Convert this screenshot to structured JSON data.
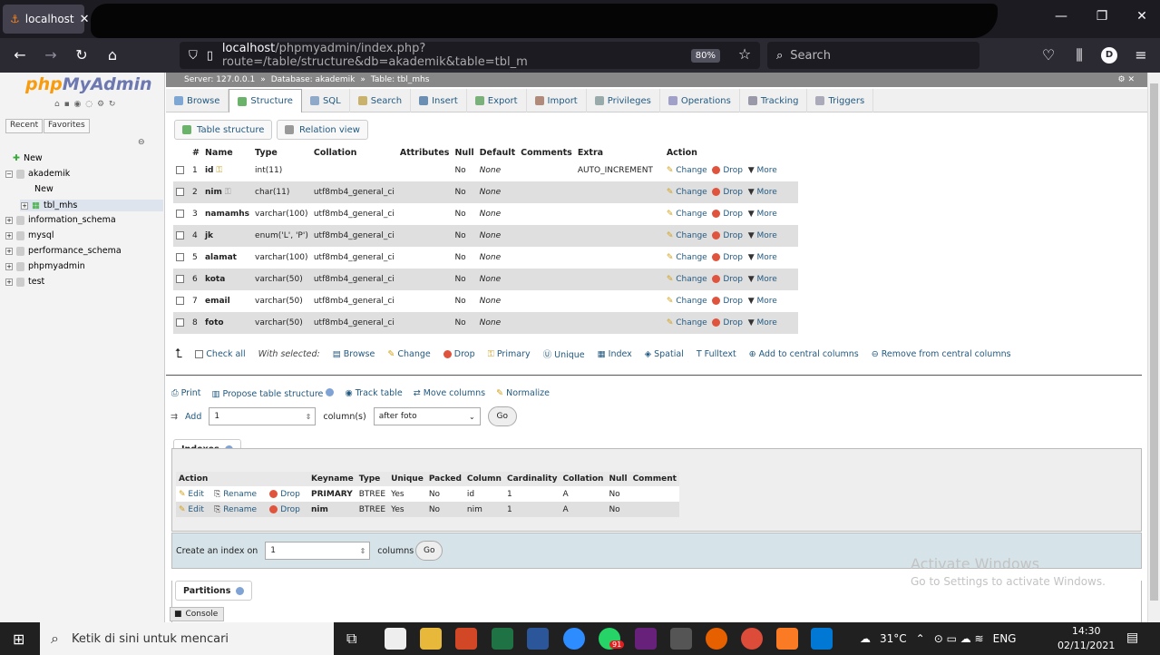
{
  "browser": {
    "tab_title": "localhost",
    "url_host": "localhost",
    "url_path": "/phpmyadmin/index.php?route=/table/structure&db=akademik&table=tbl_m",
    "zoom": "80%",
    "search_placeholder": "Search",
    "avatar_letter": "D"
  },
  "sidebar": {
    "logo_php": "php",
    "logo_myadmin": "MyAdmin",
    "tab_recent": "Recent",
    "tab_favorites": "Favorites",
    "tree": [
      "New",
      "akademik",
      "New",
      "tbl_mhs",
      "information_schema",
      "mysql",
      "performance_schema",
      "phpmyadmin",
      "test"
    ]
  },
  "breadcrumb": {
    "server": "Server: 127.0.0.1",
    "database": "Database: akademik",
    "table": "Table: tbl_mhs"
  },
  "topmenu": [
    "Browse",
    "Structure",
    "SQL",
    "Search",
    "Insert",
    "Export",
    "Import",
    "Privileges",
    "Operations",
    "Tracking",
    "Triggers"
  ],
  "subtabs": {
    "table_structure": "Table structure",
    "relation_view": "Relation view"
  },
  "structure": {
    "headers": [
      "#",
      "Name",
      "Type",
      "Collation",
      "Attributes",
      "Null",
      "Default",
      "Comments",
      "Extra",
      "Action"
    ],
    "rows": [
      {
        "num": "1",
        "name": "id",
        "type": "int(11)",
        "collation": "",
        "null": "No",
        "default": "None",
        "extra": "AUTO_INCREMENT"
      },
      {
        "num": "2",
        "name": "nim",
        "type": "char(11)",
        "collation": "utf8mb4_general_ci",
        "null": "No",
        "default": "None",
        "extra": ""
      },
      {
        "num": "3",
        "name": "namamhs",
        "type": "varchar(100)",
        "collation": "utf8mb4_general_ci",
        "null": "No",
        "default": "None",
        "extra": ""
      },
      {
        "num": "4",
        "name": "jk",
        "type": "enum('L', 'P')",
        "collation": "utf8mb4_general_ci",
        "null": "No",
        "default": "None",
        "extra": ""
      },
      {
        "num": "5",
        "name": "alamat",
        "type": "varchar(100)",
        "collation": "utf8mb4_general_ci",
        "null": "No",
        "default": "None",
        "extra": ""
      },
      {
        "num": "6",
        "name": "kota",
        "type": "varchar(50)",
        "collation": "utf8mb4_general_ci",
        "null": "No",
        "default": "None",
        "extra": ""
      },
      {
        "num": "7",
        "name": "email",
        "type": "varchar(50)",
        "collation": "utf8mb4_general_ci",
        "null": "No",
        "default": "None",
        "extra": ""
      },
      {
        "num": "8",
        "name": "foto",
        "type": "varchar(50)",
        "collation": "utf8mb4_general_ci",
        "null": "No",
        "default": "None",
        "extra": ""
      }
    ],
    "action_change": "Change",
    "action_drop": "Drop",
    "action_more": "More"
  },
  "bulk": {
    "check_all": "Check all",
    "with_selected": "With selected:",
    "actions": [
      "Browse",
      "Change",
      "Drop",
      "Primary",
      "Unique",
      "Index",
      "Spatial",
      "Fulltext",
      "Add to central columns",
      "Remove from central columns"
    ]
  },
  "tools": [
    "Print",
    "Propose table structure",
    "Track table",
    "Move columns",
    "Normalize"
  ],
  "add_column": {
    "label": "Add",
    "count": "1",
    "unit": "column(s)",
    "position": "after foto",
    "go": "Go"
  },
  "indexes": {
    "title": "Indexes",
    "headers": [
      "Action",
      "",
      "",
      "Keyname",
      "Type",
      "Unique",
      "Packed",
      "Column",
      "Cardinality",
      "Collation",
      "Null",
      "Comment"
    ],
    "edit": "Edit",
    "rename": "Rename",
    "drop": "Drop",
    "rows": [
      {
        "keyname": "PRIMARY",
        "type": "BTREE",
        "unique": "Yes",
        "packed": "No",
        "column": "id",
        "cardinality": "1",
        "collation": "A",
        "null": "No",
        "comment": ""
      },
      {
        "keyname": "nim",
        "type": "BTREE",
        "unique": "Yes",
        "packed": "No",
        "column": "nim",
        "cardinality": "1",
        "collation": "A",
        "null": "No",
        "comment": ""
      }
    ]
  },
  "create_index": {
    "label": "Create an index on",
    "count": "1",
    "unit": "columns",
    "go": "Go"
  },
  "partitions_title": "Partitions",
  "console_label": "Console",
  "watermark": {
    "line1": "Activate Windows",
    "line2": "Go to Settings to activate Windows."
  },
  "taskbar": {
    "search": "Ketik di sini untuk mencari",
    "temperature": "31°C",
    "language": "ENG",
    "time": "14:30",
    "date": "02/11/2021",
    "badge": "91"
  }
}
